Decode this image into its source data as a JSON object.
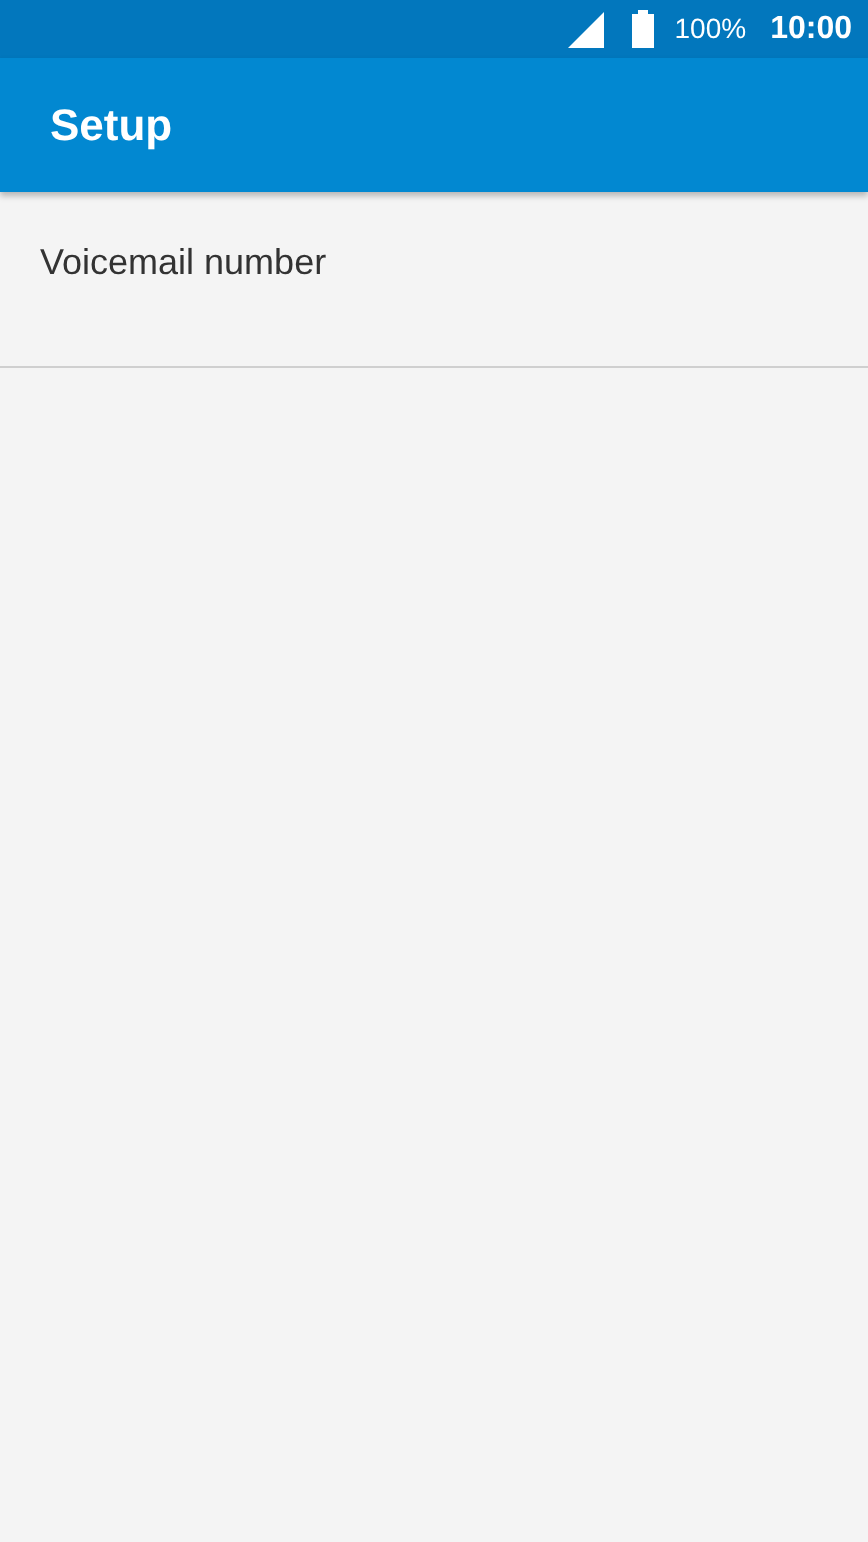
{
  "status_bar": {
    "battery_percent": "100%",
    "time": "10:00"
  },
  "app_bar": {
    "title": "Setup"
  },
  "items": [
    {
      "label": "Voicemail number"
    }
  ]
}
